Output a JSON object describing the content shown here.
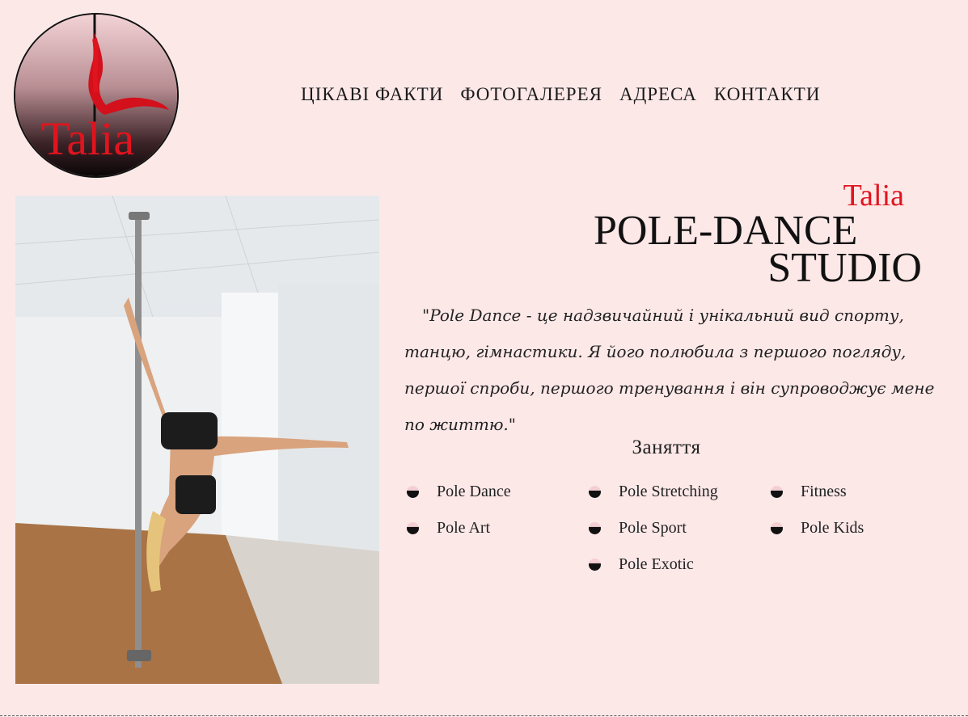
{
  "logo": {
    "text": "Talia"
  },
  "nav": {
    "items": [
      "ЦІКАВІ ФАКТИ",
      "ФОТОГАЛЕРЕЯ",
      "АДРЕСА",
      "КОНТАКТИ"
    ]
  },
  "hero": {
    "brand": "Talia",
    "line1": "POLE-DANCE",
    "line2": "STUDIO",
    "quote": "\"Pole Dance - це надзвичайний і унікальний вид спорту, танцю, гімнастики. Я його полюбила з першого погляду, першої спроби, першого тренування і він супроводжує мене по життю.\""
  },
  "classes": {
    "title": "Заняття",
    "items": [
      "Pole Dance",
      "Pole Stretching",
      "Fitness",
      "Pole Art",
      "Pole Sport",
      "Pole Kids",
      "",
      "Pole Exotic",
      ""
    ]
  },
  "colors": {
    "background": "#fde8e8",
    "accent": "#e0141e",
    "text": "#1a1a1a"
  }
}
